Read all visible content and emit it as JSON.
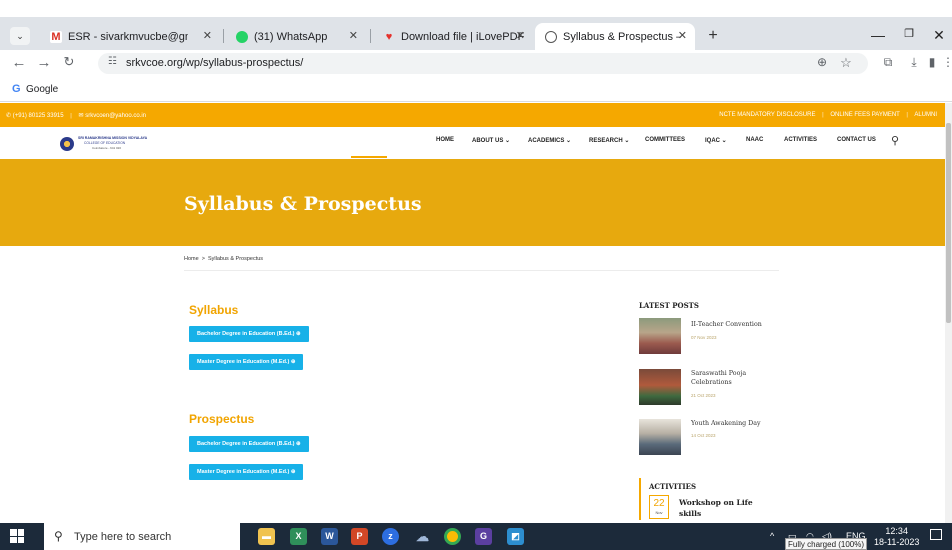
{
  "browser": {
    "tabs": [
      {
        "label": "ESR - sivarkmvucbe@gmail.com",
        "favicon": "gmail-icon",
        "active": false
      },
      {
        "label": "(31) WhatsApp",
        "favicon": "whatsapp-icon",
        "active": false
      },
      {
        "label": "Download file | iLovePDF",
        "favicon": "ilovepdf-icon",
        "active": false
      },
      {
        "label": "Syllabus & Prospectus – SRKVC",
        "favicon": "site-icon",
        "active": true
      }
    ],
    "url": "srkvcoe.org/wp/syllabus-prospectus/",
    "bookmark": "Google"
  },
  "site": {
    "topbar": {
      "phone": "(+91) 80125 33915",
      "email": "srkvcoen@yahoo.co.in",
      "links": [
        "NCTE MANDATORY DISCLOSURE",
        "ONLINE FEES PAYMENT",
        "ALUMNI"
      ]
    },
    "logo": {
      "line1": "SRI RAMAKRISHNA MISSION VIDYALAYA",
      "line2": "COLLEGE OF EDUCATION",
      "line3": "Coimbatore - 641 020"
    },
    "nav": [
      "HOME",
      "ABOUT US",
      "ACADEMICS",
      "RESEARCH",
      "COMMITTEES",
      "IQAC",
      "NAAC",
      "ACTIVITIES",
      "CONTACT US"
    ],
    "page_title": "Syllabus & Prospectus",
    "breadcrumb": {
      "home": "Home",
      "separator": ">",
      "current": "Syllabus & Prospectus"
    },
    "syllabus": {
      "heading": "Syllabus",
      "buttons": [
        "Bachelor Degree in Education (B.Ed.) ⊕",
        "Master Degree in Education (M.Ed.) ⊕"
      ]
    },
    "prospectus": {
      "heading": "Prospectus",
      "buttons": [
        "Bachelor Degree in Education (B.Ed.) ⊕",
        "Master Degree in Education (M.Ed.) ⊕"
      ]
    },
    "latest_posts": {
      "heading": "LATEST POSTS",
      "items": [
        {
          "title": "II-Teacher Convention",
          "date": "07 Nov 2023"
        },
        {
          "title": "Saraswathi Pooja Celebrations",
          "date": "21 Oct 2023"
        },
        {
          "title": "Youth Awakening Day",
          "date": "14 Oct 2023"
        }
      ]
    },
    "activities": {
      "heading": "ACTIVITIES",
      "day": "22",
      "month": "Nov",
      "title": "Workshop on Life skills"
    }
  },
  "taskbar": {
    "search_placeholder": "Type here to search",
    "language": "ENG",
    "time": "12:34",
    "date": "18-11-2023",
    "battery_tooltip": "Fully charged (100%)"
  },
  "colors": {
    "accent": "#f5a800",
    "hero": "#e7a90e",
    "button": "#17b1e8",
    "taskbar": "#1c2a3a"
  }
}
